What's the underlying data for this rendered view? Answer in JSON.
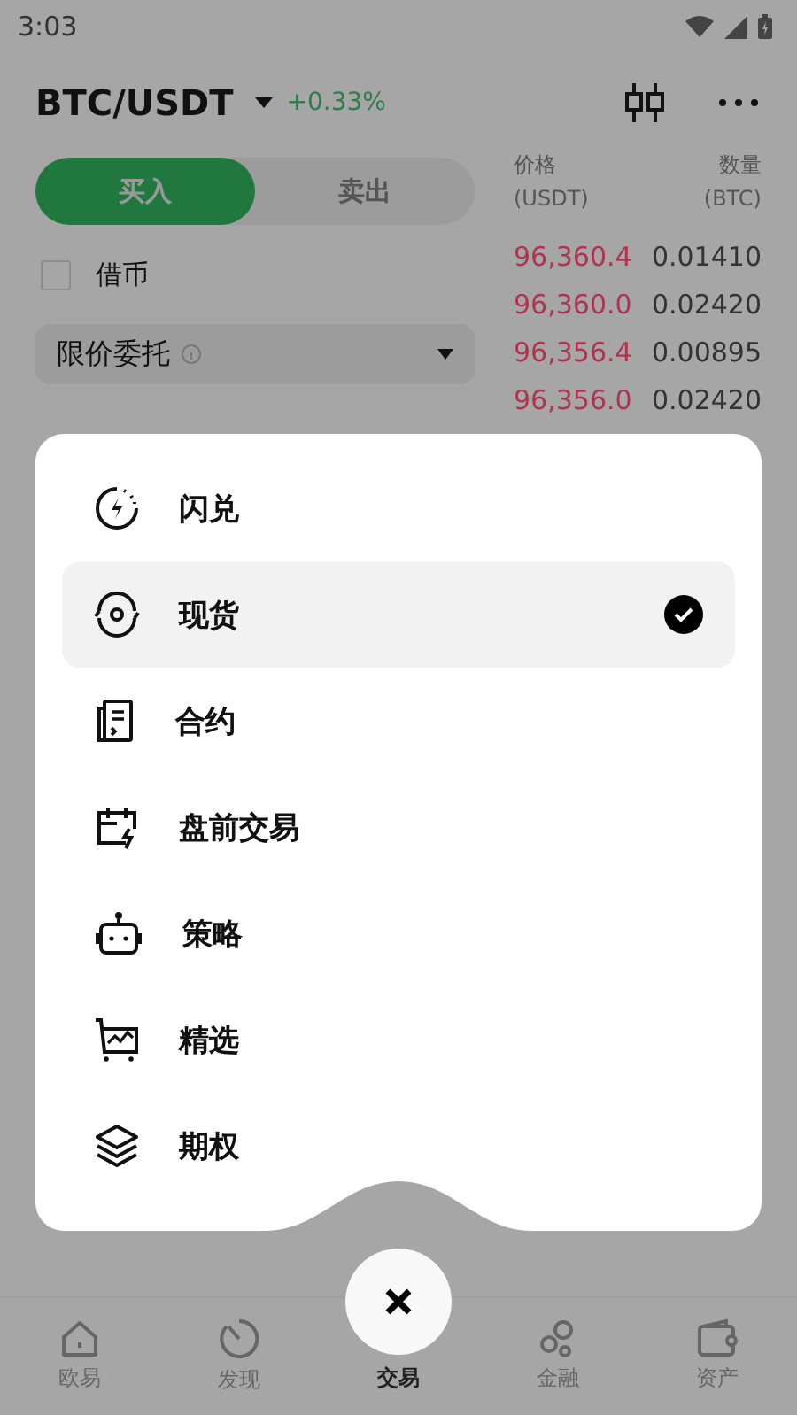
{
  "status_bar": {
    "time": "3:03"
  },
  "header": {
    "pair": "BTC/USDT",
    "change": "+0.33%"
  },
  "side_tabs": [
    {
      "label": "买入",
      "selected": true
    },
    {
      "label": "卖出",
      "selected": false
    }
  ],
  "borrow": {
    "label": "借币",
    "checked": false
  },
  "order_type": {
    "label": "限价委托"
  },
  "order_book": {
    "columns": [
      {
        "label": "价格",
        "unit": "(USDT)"
      },
      {
        "label": "数量",
        "unit": "(BTC)"
      }
    ],
    "rows": [
      {
        "price": "96,360.4",
        "amount": "0.01410"
      },
      {
        "price": "96,360.0",
        "amount": "0.02420"
      },
      {
        "price": "96,356.4",
        "amount": "0.00895"
      },
      {
        "price": "96,356.0",
        "amount": "0.02420"
      }
    ]
  },
  "menu": {
    "items": [
      {
        "kind": "flash",
        "label": "闪兑",
        "selected": false
      },
      {
        "kind": "spot",
        "label": "现货",
        "selected": true
      },
      {
        "kind": "contract",
        "label": "合约",
        "selected": false
      },
      {
        "kind": "premarket",
        "label": "盘前交易",
        "selected": false
      },
      {
        "kind": "bot",
        "label": "策略",
        "selected": false
      },
      {
        "kind": "select",
        "label": "精选",
        "selected": false
      },
      {
        "kind": "options",
        "label": "期权",
        "selected": false
      }
    ]
  },
  "bottom_nav": [
    {
      "kind": "home",
      "label": "欧易",
      "selected": false
    },
    {
      "kind": "discover",
      "label": "发现",
      "selected": false
    },
    {
      "kind": "trade",
      "label": "交易",
      "selected": true
    },
    {
      "kind": "finance",
      "label": "金融",
      "selected": false
    },
    {
      "kind": "assets",
      "label": "资产",
      "selected": false
    }
  ]
}
